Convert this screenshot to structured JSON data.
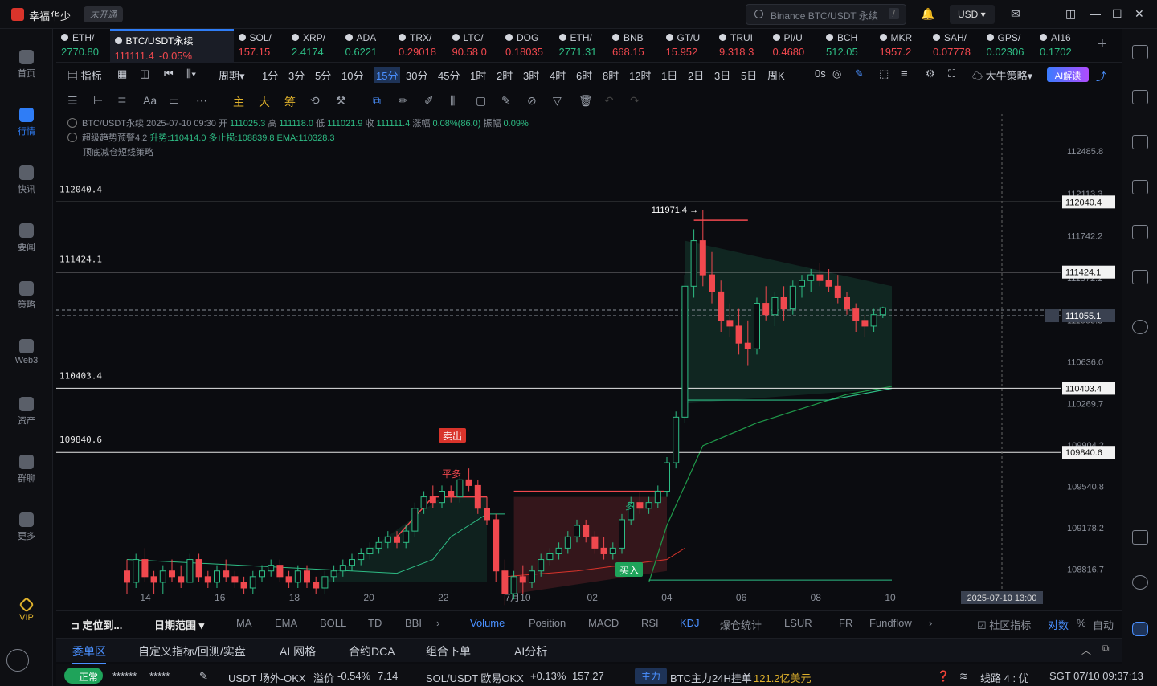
{
  "app": {
    "name": "幸福华少",
    "badge": "未开通",
    "search_placeholder": "Binance BTC/USDT 永续",
    "search_shortcut": "/",
    "currency": "USD"
  },
  "left_nav": [
    {
      "label": "首页",
      "icon": "home-icon"
    },
    {
      "label": "行情",
      "icon": "market-icon",
      "active": true
    },
    {
      "label": "快讯",
      "icon": "news-icon"
    },
    {
      "label": "要闻",
      "icon": "headline-icon"
    },
    {
      "label": "策略",
      "icon": "strategy-icon"
    },
    {
      "label": "Web3",
      "icon": "web3-icon"
    },
    {
      "label": "资产",
      "icon": "wallet-icon"
    },
    {
      "label": "群聊",
      "icon": "chat-icon"
    },
    {
      "label": "更多",
      "icon": "more-icon"
    },
    {
      "label": "VIP",
      "icon": "vip-icon"
    }
  ],
  "tickers": [
    {
      "name": "ETH/",
      "price": "2770.80",
      "dir": "up"
    },
    {
      "name": "BTC/USDT永续",
      "price": "111111.4",
      "change": "-0.05%",
      "dir": "dn",
      "active": true
    },
    {
      "name": "SOL/",
      "price": "157.15",
      "dir": "dn"
    },
    {
      "name": "XRP/",
      "price": "2.4174",
      "dir": "up"
    },
    {
      "name": "ADA",
      "price": "0.6221",
      "dir": "up"
    },
    {
      "name": "TRX/",
      "price": "0.29018",
      "dir": "dn"
    },
    {
      "name": "LTC/",
      "price": "90.58 0",
      "dir": "dn"
    },
    {
      "name": "DOG",
      "price": "0.18035",
      "dir": "dn"
    },
    {
      "name": "ETH/",
      "price": "2771.31",
      "dir": "up"
    },
    {
      "name": "BNB",
      "price": "668.15",
      "dir": "dn"
    },
    {
      "name": "GT/U",
      "price": "15.952",
      "dir": "dn"
    },
    {
      "name": "TRUI",
      "price": "9.318 3",
      "dir": "dn"
    },
    {
      "name": "PI/U",
      "price": "0.4680",
      "dir": "dn"
    },
    {
      "name": "BCH",
      "price": "512.05",
      "dir": "up"
    },
    {
      "name": "MKR",
      "price": "1957.2",
      "dir": "dn"
    },
    {
      "name": "SAH/",
      "price": "0.07778",
      "dir": "dn"
    },
    {
      "name": "GPS/",
      "price": "0.02306",
      "dir": "up"
    },
    {
      "name": "AI16",
      "price": "0.1702",
      "dir": "up"
    }
  ],
  "toolbar": {
    "indicator": "指标",
    "period": "周期",
    "periods": [
      "1分",
      "3分",
      "5分",
      "10分",
      "15分",
      "30分",
      "45分",
      "1时",
      "2时",
      "3时",
      "4时",
      "6时",
      "8时",
      "12时",
      "1日",
      "2日",
      "3日",
      "5日",
      "周K"
    ],
    "active_period": "15分",
    "countdown": "0s",
    "strategy": "大牛策略",
    "ai": "AI解读"
  },
  "draw_tools": {
    "labels": [
      "主",
      "大",
      "筹"
    ]
  },
  "info": {
    "line1": {
      "symbol": "BTC/USDT永续",
      "time": "2025-07-10 09:30",
      "open_label": "开",
      "open": "111025.3",
      "high_label": "高",
      "high": "111118.0",
      "low_label": "低",
      "low": "111021.9",
      "close_label": "收",
      "close": "111111.4",
      "chg_label": "涨幅",
      "chg": "0.08%(86.0)",
      "amp_label": "振幅",
      "amp": "0.09%"
    },
    "line2": {
      "name": "超级趋势预警4.2",
      "a": "升势:110414.0",
      "b": "多止损:108839.8",
      "c": "EMA:110328.3"
    },
    "line3": {
      "name": "顶底减仓短线策略"
    }
  },
  "chart_data": {
    "type": "candlestick",
    "symbol": "BTC/USDT永续",
    "interval": "15分",
    "y_ticks": [
      "112485.8",
      "112113.3",
      "111742.2",
      "111372.2",
      "111003.3",
      "110636.0",
      "110269.7",
      "109904.2",
      "109540.8",
      "109178.2",
      "108816.7"
    ],
    "x_ticks": [
      "14",
      "16",
      "18",
      "20",
      "22",
      "7月10",
      "02",
      "04",
      "06",
      "08",
      "10"
    ],
    "horizontal_levels": [
      "112040.4",
      "111424.1",
      "110403.4",
      "109840.6"
    ],
    "current_price": "111055.1",
    "last_price": "111111.4",
    "high_marker": "111971.4",
    "crosshair_time": "2025-07-10 13:00",
    "signals": {
      "sell": "卖出",
      "close_long": "平多",
      "buy": "买入",
      "long": "多"
    },
    "candles": [
      [
        108800,
        108900,
        108600,
        108700
      ],
      [
        108700,
        108950,
        108650,
        108900
      ],
      [
        108900,
        109000,
        108700,
        108750
      ],
      [
        108750,
        108800,
        108600,
        108700
      ],
      [
        108700,
        108850,
        108600,
        108800
      ],
      [
        108800,
        108900,
        108700,
        108750
      ],
      [
        108750,
        108850,
        108650,
        108700
      ],
      [
        108700,
        108950,
        108700,
        108900
      ],
      [
        108900,
        108950,
        108700,
        108750
      ],
      [
        108750,
        108800,
        108650,
        108700
      ],
      [
        108700,
        108850,
        108650,
        108800
      ],
      [
        108800,
        108900,
        108700,
        108750
      ],
      [
        108750,
        108800,
        108650,
        108700
      ],
      [
        108700,
        108750,
        108600,
        108650
      ],
      [
        108650,
        108800,
        108600,
        108750
      ],
      [
        108750,
        108850,
        108700,
        108800
      ],
      [
        108800,
        108900,
        108750,
        108850
      ],
      [
        108850,
        108900,
        108700,
        108750
      ],
      [
        108750,
        108800,
        108650,
        108700
      ],
      [
        108700,
        108850,
        108650,
        108800
      ],
      [
        108800,
        108850,
        108650,
        108700
      ],
      [
        108700,
        108750,
        108600,
        108650
      ],
      [
        108650,
        108800,
        108600,
        108750
      ],
      [
        108750,
        108850,
        108700,
        108800
      ],
      [
        108800,
        108900,
        108750,
        108850
      ],
      [
        108850,
        108950,
        108800,
        108900
      ],
      [
        108900,
        109000,
        108850,
        108950
      ],
      [
        108950,
        109050,
        108900,
        109000
      ],
      [
        109000,
        109100,
        108950,
        109050
      ],
      [
        109050,
        109150,
        109000,
        109100
      ],
      [
        109100,
        109150,
        109000,
        109050
      ],
      [
        109050,
        109200,
        109000,
        109150
      ],
      [
        109150,
        109400,
        109100,
        109350
      ],
      [
        109350,
        109500,
        109300,
        109450
      ],
      [
        109450,
        109550,
        109350,
        109400
      ],
      [
        109400,
        109550,
        109350,
        109500
      ],
      [
        109500,
        109550,
        109400,
        109450
      ],
      [
        109450,
        109650,
        109400,
        109600
      ],
      [
        109600,
        109700,
        109500,
        109550
      ],
      [
        109550,
        109600,
        109300,
        109350
      ],
      [
        109350,
        109450,
        109200,
        109250
      ],
      [
        109250,
        109300,
        108700,
        108800
      ],
      [
        108800,
        108900,
        108500,
        108600
      ],
      [
        108600,
        108800,
        108550,
        108750
      ],
      [
        108750,
        108850,
        108600,
        108700
      ],
      [
        108700,
        108850,
        108650,
        108800
      ],
      [
        108800,
        108950,
        108750,
        108900
      ],
      [
        108900,
        109000,
        108850,
        108950
      ],
      [
        108950,
        109050,
        108900,
        109000
      ],
      [
        109000,
        109150,
        108950,
        109100
      ],
      [
        109100,
        109250,
        109050,
        109200
      ],
      [
        109200,
        109250,
        109050,
        109100
      ],
      [
        109100,
        109150,
        108950,
        109000
      ],
      [
        109000,
        109100,
        108900,
        108950
      ],
      [
        108950,
        109050,
        108900,
        109000
      ],
      [
        109000,
        109300,
        108950,
        109250
      ],
      [
        109250,
        109450,
        109200,
        109400
      ],
      [
        109400,
        109500,
        109300,
        109350
      ],
      [
        109350,
        109450,
        109300,
        109400
      ],
      [
        109400,
        109550,
        109350,
        109500
      ],
      [
        109500,
        109800,
        109450,
        109750
      ],
      [
        109750,
        110200,
        109700,
        110150
      ],
      [
        110150,
        111400,
        110100,
        111300
      ],
      [
        111300,
        111800,
        111200,
        111700
      ],
      [
        111700,
        111971,
        111300,
        111400
      ],
      [
        111400,
        111600,
        111150,
        111250
      ],
      [
        111250,
        111350,
        110900,
        111000
      ],
      [
        111000,
        111150,
        110850,
        110950
      ],
      [
        110950,
        111100,
        110700,
        110800
      ],
      [
        110800,
        111000,
        110600,
        110750
      ],
      [
        110750,
        111200,
        110700,
        111150
      ],
      [
        111150,
        111300,
        111000,
        111050
      ],
      [
        111050,
        111250,
        110950,
        111200
      ],
      [
        111200,
        111300,
        111000,
        111100
      ],
      [
        111100,
        111350,
        111050,
        111300
      ],
      [
        111300,
        111400,
        111200,
        111350
      ],
      [
        111350,
        111450,
        111250,
        111400
      ],
      [
        111400,
        111500,
        111300,
        111350
      ],
      [
        111350,
        111450,
        111250,
        111300
      ],
      [
        111300,
        111400,
        111150,
        111200
      ],
      [
        111200,
        111250,
        111050,
        111100
      ],
      [
        111100,
        111150,
        110900,
        111000
      ],
      [
        111000,
        111050,
        110850,
        110950
      ],
      [
        110950,
        111100,
        110900,
        111050
      ],
      [
        111050,
        111120,
        111020,
        111111
      ]
    ]
  },
  "bottom_tabs": {
    "locate": "定位到...",
    "range": "日期范围",
    "items": [
      "MA",
      "EMA",
      "BOLL",
      "TD",
      "BBI",
      "Volume",
      "Position",
      "MACD",
      "RSI",
      "KDJ",
      "爆仓统计",
      "LSUR",
      "FR",
      "Fundflow"
    ],
    "community": "社区指标",
    "log": "对数",
    "pct": "%",
    "auto": "自动"
  },
  "panel_tabs": [
    "委单区",
    "自定义指标/回测/实盘",
    "AI 网格",
    "合约DCA",
    "组合下单",
    "AI分析"
  ],
  "status": {
    "ok": "正常",
    "masked1": "******",
    "masked2": "*****",
    "otc": "USDT 场外-OKX",
    "premium_label": "溢价",
    "premium": "-0.54%",
    "otc_price": "7.14",
    "pair": "SOL/USDT 欧易OKX",
    "pair_chg": "+0.13%",
    "pair_price": "157.27",
    "main_force": "主力",
    "mf_text": "BTC主力24H挂单",
    "mf_value": "121.2亿美元",
    "line": "线路 4 : 优",
    "clock": "SGT 07/10 09:37:13"
  }
}
